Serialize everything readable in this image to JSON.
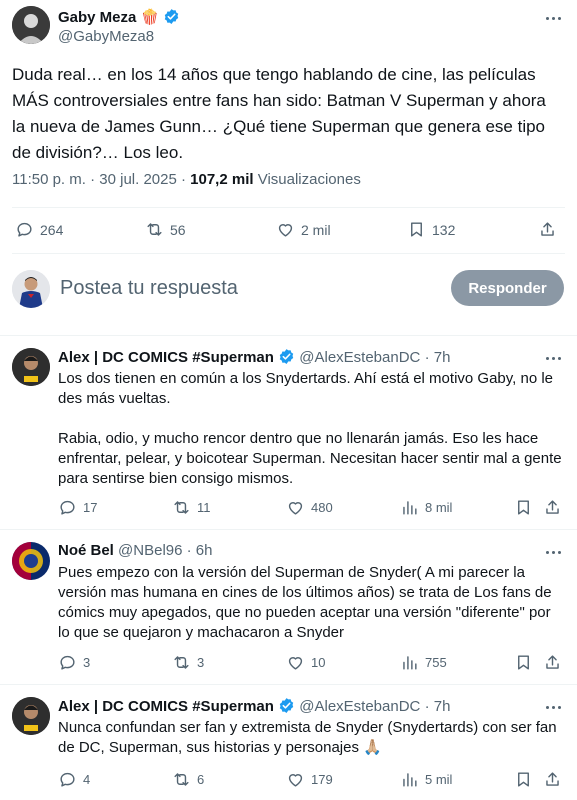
{
  "post": {
    "display_name": "Gaby Meza",
    "name_emoji": "🍿",
    "handle": "@GabyMeza8",
    "text": "Duda real… en los 14 años que tengo hablando de cine, las películas MÁS controversiales entre fans han sido: Batman V Superman y ahora la nueva de James Gunn… ¿Qué tiene Superman que genera ese tipo de división?… Los leo.",
    "time": "11:50 p. m. · 30 jul. 2025 · ",
    "views_count": "107,2 mil",
    "views_label": " Visualizaciones",
    "replies": "264",
    "retweets": "56",
    "likes": "2 mil",
    "bookmarks": "132"
  },
  "composer": {
    "placeholder": "Postea tu respuesta",
    "button_label": "Responder"
  },
  "replies": [
    {
      "name": "Alex | DC COMICS #Superman",
      "handle": "@AlexEstebanDC",
      "time": "· 7h",
      "text": "Los dos tienen en común a los Snydertards. Ahí está el motivo Gaby, no le des más vueltas.\n\nRabia, odio, y mucho rencor dentro que no llenarán jamás. Eso les hace enfrentar, pelear, y boicotear Superman. Necesitan hacer sentir mal a gente para sentirse bien consigo mismos.",
      "replies": "17",
      "retweets": "11",
      "likes": "480",
      "views": "8 mil"
    },
    {
      "name": "Noé Bel",
      "handle": "@NBel96",
      "time": "· 6h",
      "text": "Pues empezo con la versión del Superman de Snyder( A mi parecer la versión mas humana en cines de los últimos años) se trata de Los fans de cómics muy apegados, que no pueden aceptar una versión \"diferente\" por lo que se quejaron y machacaron a Snyder",
      "replies": "3",
      "retweets": "3",
      "likes": "10",
      "views": "755"
    },
    {
      "name": "Alex | DC COMICS #Superman",
      "handle": "@AlexEstebanDC",
      "time": "· 7h",
      "text": "Nunca confundan ser fan y extremista de Snyder (Snydertards) con ser fan de DC, Superman, sus historias y personajes 🙏🏼",
      "replies": "4",
      "retweets": "6",
      "likes": "179",
      "views": "5 mil"
    }
  ],
  "colors": {
    "verified": "#1d9bf0",
    "button_bg": "#8b98a5",
    "muted": "#536471"
  }
}
